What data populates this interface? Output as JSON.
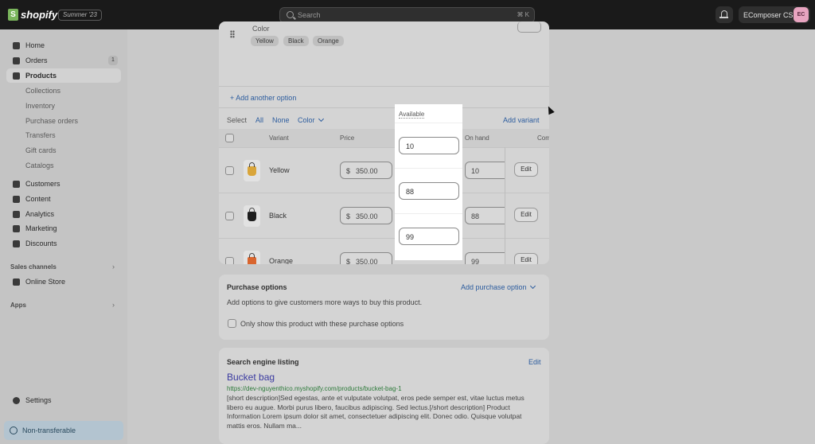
{
  "topbar": {
    "logo_mark": "S",
    "logo_text": "shopify",
    "edition": "Summer '23",
    "search_placeholder": "Search",
    "search_shortcut": "⌘ K",
    "store_name": "EComposer CS",
    "avatar_initials": "EC"
  },
  "sidebar": {
    "items": [
      {
        "label": "Home",
        "icon": "home-icon"
      },
      {
        "label": "Orders",
        "icon": "orders-icon",
        "badge": "1"
      },
      {
        "label": "Products",
        "icon": "tag-icon",
        "active": true
      },
      {
        "label": "Customers",
        "icon": "person-icon"
      },
      {
        "label": "Content",
        "icon": "content-icon"
      },
      {
        "label": "Analytics",
        "icon": "chart-icon"
      },
      {
        "label": "Marketing",
        "icon": "target-icon"
      },
      {
        "label": "Discounts",
        "icon": "discount-icon"
      }
    ],
    "product_subitems": [
      "Collections",
      "Inventory",
      "Purchase orders",
      "Transfers",
      "Gift cards",
      "Catalogs"
    ],
    "sales_channels_label": "Sales channels",
    "online_store": "Online Store",
    "apps_label": "Apps",
    "settings": "Settings",
    "non_transferable": "Non-transferable"
  },
  "variants_card": {
    "option_name": "Color",
    "option_values": [
      "Yellow",
      "Black",
      "Orange"
    ],
    "add_option": "+ Add another option",
    "select_label": "Select",
    "select_all": "All",
    "select_none": "None",
    "select_color": "Color",
    "add_variant": "Add variant",
    "columns": {
      "variant": "Variant",
      "price": "Price",
      "available": "Available",
      "on_hand": "On hand",
      "committed": "Com"
    },
    "currency_symbol": "$",
    "edit_label": "Edit",
    "rows": [
      {
        "name": "Yellow",
        "price": "350.00",
        "available": "10",
        "on_hand": "10",
        "color": "#d9a53a"
      },
      {
        "name": "Black",
        "price": "350.00",
        "available": "88",
        "on_hand": "88",
        "color": "#1e1e1e"
      },
      {
        "name": "Orange",
        "price": "350.00",
        "available": "99",
        "on_hand": "99",
        "color": "#d9652e"
      }
    ]
  },
  "purchase_options": {
    "title": "Purchase options",
    "action": "Add purchase option",
    "description": "Add options to give customers more ways to buy this product.",
    "checkbox_label": "Only show this product with these purchase options"
  },
  "seo": {
    "title": "Search engine listing",
    "edit": "Edit",
    "page_title": "Bucket bag",
    "url": "https://dev-nguyenthico.myshopify.com/products/bucket-bag-1",
    "description": "[short description]Sed egestas, ante et vulputate volutpat, eros pede semper est, vitae luctus metus libero eu augue. Morbi purus libero, faucibus adipiscing. Sed lectus.[/short description] Product Information Lorem ipsum dolor sit amet, consectetuer adipiscing elit. Donec odio. Quisque volutpat mattis eros. Nullam ma..."
  }
}
